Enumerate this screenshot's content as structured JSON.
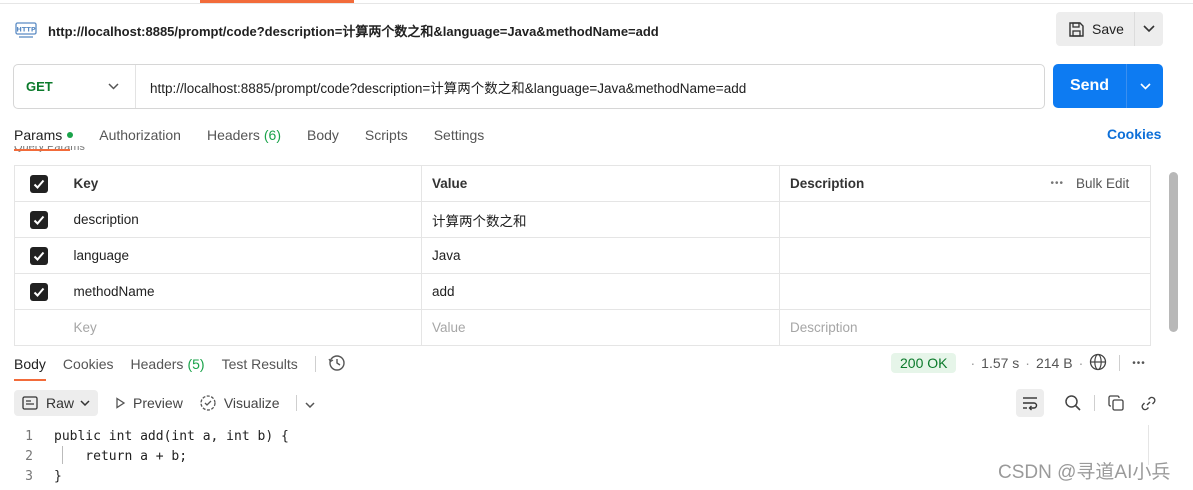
{
  "request": {
    "title": "http://localhost:8885/prompt/code?description=计算两个数之和&language=Java&methodName=add",
    "save_label": "Save",
    "method": "GET",
    "url": "http://localhost:8885/prompt/code?description=计算两个数之和&language=Java&methodName=add",
    "send_label": "Send"
  },
  "request_tabs": [
    {
      "label": "Params"
    },
    {
      "label": "Authorization"
    },
    {
      "label": "Headers",
      "count": "(6)"
    },
    {
      "label": "Body"
    },
    {
      "label": "Scripts"
    },
    {
      "label": "Settings"
    }
  ],
  "cookies_label": "Cookies",
  "clipped_label": "Query Params",
  "params_table": {
    "headers": {
      "key": "Key",
      "value": "Value",
      "description": "Description",
      "bulk_edit": "Bulk Edit"
    },
    "rows": [
      {
        "key": "description",
        "value": "计算两个数之和",
        "description": ""
      },
      {
        "key": "language",
        "value": "Java",
        "description": ""
      },
      {
        "key": "methodName",
        "value": "add",
        "description": ""
      }
    ],
    "placeholders": {
      "key": "Key",
      "value": "Value",
      "description": "Description"
    }
  },
  "response_tabs": [
    {
      "label": "Body"
    },
    {
      "label": "Cookies"
    },
    {
      "label": "Headers",
      "count": "(5)"
    },
    {
      "label": "Test Results"
    }
  ],
  "response_status": {
    "code": "200 OK",
    "time": "1.57 s",
    "size": "214 B"
  },
  "response_toolbar": {
    "format": "Raw",
    "preview": "Preview",
    "visualize": "Visualize"
  },
  "code_lines": [
    {
      "n": "1",
      "text": "public int add(int a, int b) {"
    },
    {
      "n": "2",
      "text": "    return a + b;"
    },
    {
      "n": "3",
      "text": "}"
    }
  ],
  "watermark": "CSDN @寻道AI小兵",
  "colors": {
    "accent": "#f26b3a",
    "send": "#0d7bf2",
    "method_get": "#0b7a2b",
    "status_ok_bg": "#e6f5e9"
  },
  "icons": [
    "http-icon",
    "save-icon",
    "chevron-down-icon",
    "history-icon",
    "globe-icon",
    "more-icon",
    "raw-format-icon",
    "play-icon",
    "visualize-icon",
    "wrap-lines-icon",
    "search-icon",
    "copy-icon",
    "link-icon"
  ]
}
